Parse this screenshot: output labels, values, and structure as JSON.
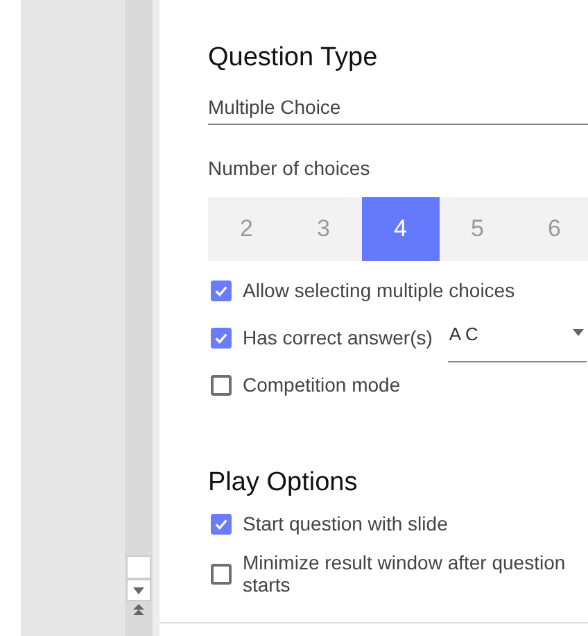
{
  "question_type": {
    "title": "Question Type",
    "dropdown": {
      "value": "Multiple Choice"
    }
  },
  "number_of_choices": {
    "label": "Number of choices",
    "options": [
      {
        "label": "2",
        "selected": false
      },
      {
        "label": "3",
        "selected": false
      },
      {
        "label": "4",
        "selected": true
      },
      {
        "label": "5",
        "selected": false
      },
      {
        "label": "6",
        "selected": false
      }
    ]
  },
  "options": [
    {
      "label": "Allow selecting multiple choices",
      "checked": true
    },
    {
      "label": "Has correct answer(s)",
      "checked": true,
      "answer": "A C"
    },
    {
      "label": "Competition mode",
      "checked": false
    }
  ],
  "play_options": {
    "title": "Play Options",
    "options": [
      {
        "label": "Start question with slide",
        "checked": true
      },
      {
        "label": "Minimize result window after question starts",
        "checked": false
      }
    ]
  }
}
